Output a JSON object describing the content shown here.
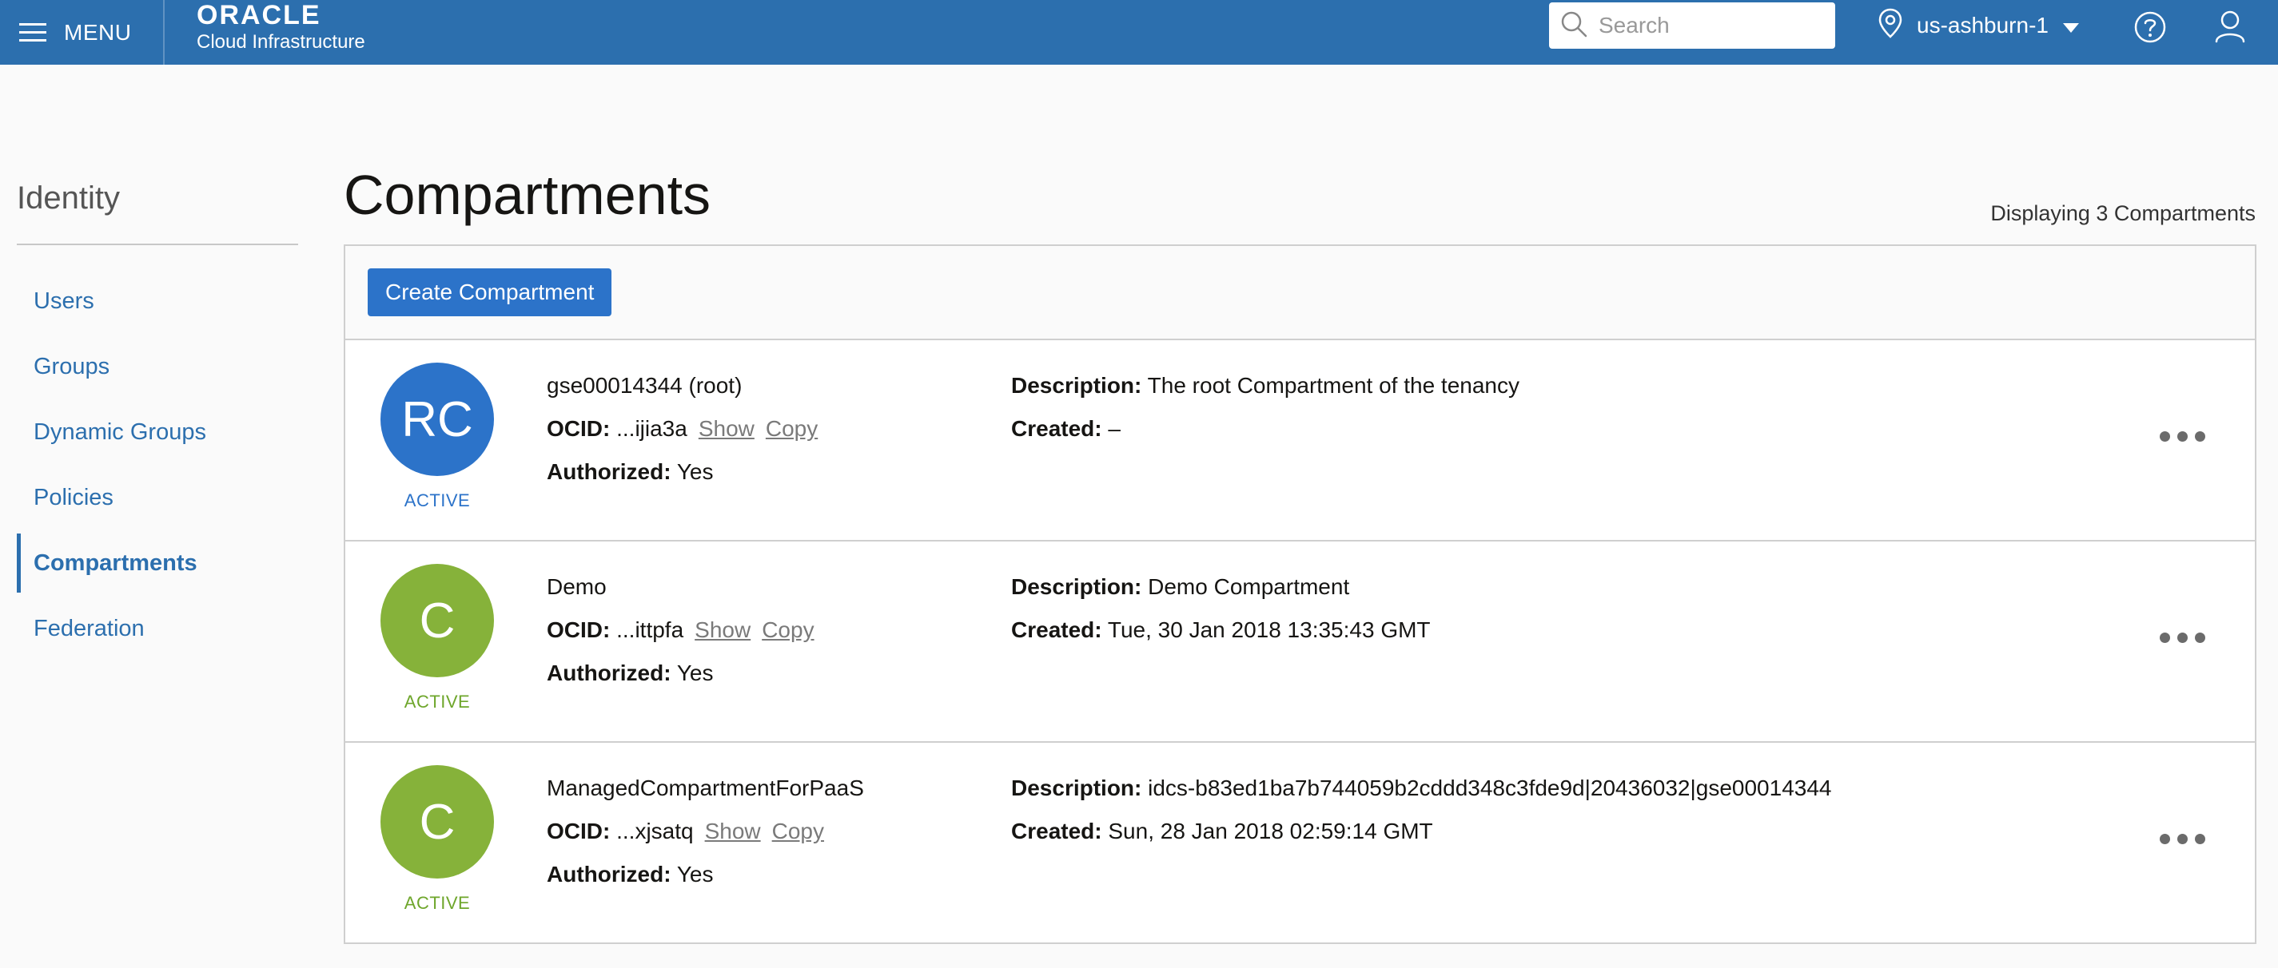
{
  "header": {
    "menu_label": "MENU",
    "logo_brand": "ORACLE",
    "logo_sub": "Cloud Infrastructure",
    "search_placeholder": "Search",
    "region": "us-ashburn-1",
    "icons": [
      "hamburger-icon",
      "search-icon",
      "location-pin-icon",
      "caret-down-icon",
      "help-icon",
      "user-icon"
    ]
  },
  "sidebar": {
    "title": "Identity",
    "items": [
      {
        "label": "Users",
        "active": false
      },
      {
        "label": "Groups",
        "active": false
      },
      {
        "label": "Dynamic Groups",
        "active": false
      },
      {
        "label": "Policies",
        "active": false
      },
      {
        "label": "Compartments",
        "active": true
      },
      {
        "label": "Federation",
        "active": false
      }
    ]
  },
  "main": {
    "title": "Compartments",
    "displaying": "Displaying 3 Compartments",
    "create_button": "Create Compartment",
    "labels": {
      "ocid": "OCID:",
      "authorized": "Authorized:",
      "description": "Description:",
      "created": "Created:",
      "show": "Show",
      "copy": "Copy"
    },
    "rows": [
      {
        "initials": "RC",
        "avatar_color": "#2c73c9",
        "status": "ACTIVE",
        "status_color": "#2c73c9",
        "name": "gse00014344 (root)",
        "ocid": "...ijia3a",
        "authorized": "Yes",
        "description": "The root Compartment of the tenancy",
        "created": "–"
      },
      {
        "initials": "C",
        "avatar_color": "#86b23a",
        "status": "ACTIVE",
        "status_color": "#6ea62b",
        "name": "Demo",
        "ocid": "...ittpfa",
        "authorized": "Yes",
        "description": "Demo Compartment",
        "created": "Tue, 30 Jan 2018 13:35:43 GMT"
      },
      {
        "initials": "C",
        "avatar_color": "#86b23a",
        "status": "ACTIVE",
        "status_color": "#6ea62b",
        "name": "ManagedCompartmentForPaaS",
        "ocid": "...xjsatq",
        "authorized": "Yes",
        "description": "idcs-b83ed1ba7b744059b2cddd348c3fde9d|20436032|gse00014344",
        "created": "Sun, 28 Jan 2018 02:59:14 GMT"
      }
    ]
  }
}
